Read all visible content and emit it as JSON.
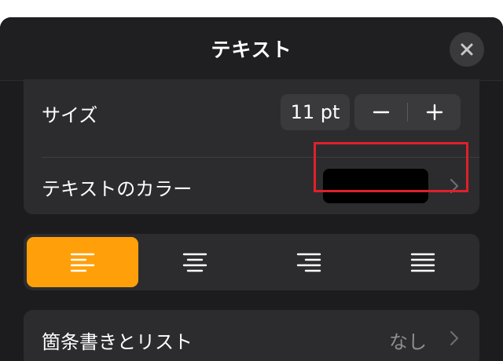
{
  "header": {
    "title": "テキスト",
    "close_icon": "xmark-icon"
  },
  "size_row": {
    "label": "サイズ",
    "value": "11 pt",
    "decrement_symbol": "−",
    "increment_symbol": "+"
  },
  "color_row": {
    "label": "テキストのカラー",
    "swatch_color": "#000000",
    "chevron_icon": "chevron-right-icon"
  },
  "alignment": {
    "options": [
      "left",
      "center",
      "right",
      "justify"
    ],
    "selected": "left",
    "accent_color": "#ff9f0a"
  },
  "list_row": {
    "label": "箇条書きとリスト",
    "value": "なし",
    "chevron_icon": "chevron-right-icon"
  },
  "colors": {
    "background": "#1c1c1e",
    "card": "#2c2c2e",
    "highlight_border": "#e0202a"
  }
}
